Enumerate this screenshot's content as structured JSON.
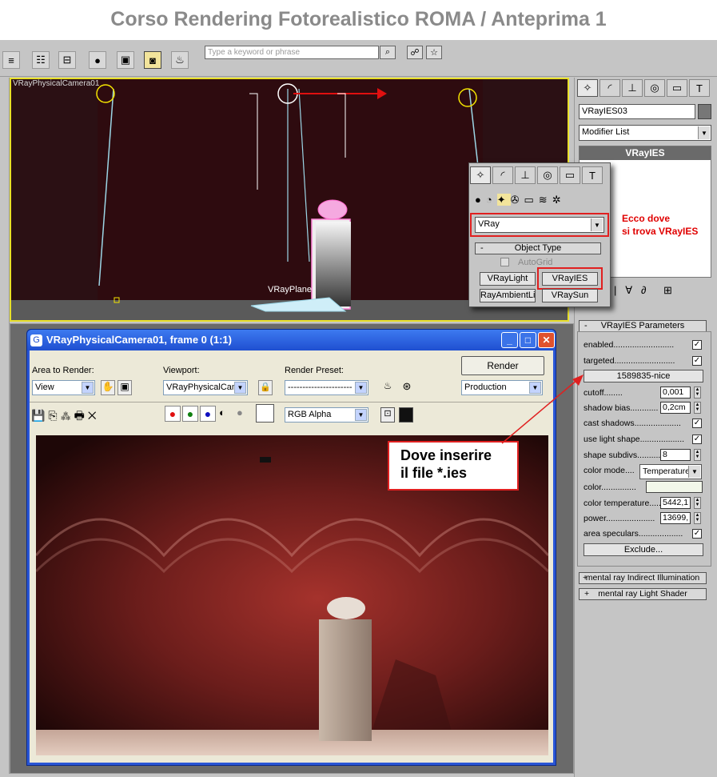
{
  "header": {
    "title": "Corso Rendering Fotorealistico ROMA / Anteprima 1"
  },
  "toolbar": {
    "search_placeholder": "Type a keyword or phrase"
  },
  "viewport": {
    "label": "VRayPhysicalCamera01",
    "plane_label": "VRayPlane"
  },
  "command_panel": {
    "object_name": "VRayIES03",
    "modifier_list": "Modifier List",
    "stack_item": "VRayIES"
  },
  "popup": {
    "category": "VRay",
    "rollout_title": "Object Type",
    "collapse_sign": "-",
    "autogrid": "AutoGrid",
    "buttons": [
      "VRayLight",
      "VRayIES",
      "RayAmbientLig",
      "VRaySun"
    ]
  },
  "annotations": {
    "ecco_line1": "Ecco dove",
    "ecco_line2": "si trova VRayIES",
    "dove_line1": "Dove inserire",
    "dove_line2": "il file *.ies"
  },
  "params": {
    "rollout_title": "VRayIES Parameters",
    "collapse_sign": "-",
    "enabled": "enabled..........................",
    "targeted": "targeted..........................",
    "ies_file": "1589835-nice",
    "cutoff": "cutoff........",
    "cutoff_val": "0,001",
    "shadow_bias": "shadow bias............",
    "shadow_bias_val": "0,2cm",
    "cast_shadows": "cast shadows....................",
    "use_light_shape": "use light shape...................",
    "shape_subdivs": "shape subdivs...........",
    "shape_subdivs_val": "8",
    "color_mode": "color mode....",
    "color_mode_val": "Temperature",
    "color": "color...............",
    "color_temperature": "color temperature......",
    "color_temperature_val": "5442,1",
    "power": "power.....................",
    "power_val": "13699,",
    "area_speculars": "area speculars...................",
    "exclude": "Exclude...",
    "mr_indirect": "mental ray Indirect Illumination",
    "mr_indirect_sign": "+",
    "mr_shader": "mental ray Light Shader",
    "mr_shader_sign": "+",
    "colors": {
      "color_swatch": "#f2f7ea"
    }
  },
  "render_window": {
    "title": "VRayPhysicalCamera01, frame 0 (1:1)",
    "area_label": "Area to Render:",
    "area_value": "View",
    "viewport_label": "Viewport:",
    "viewport_value": "VRayPhysicalCam",
    "preset_label": "Render Preset:",
    "preset_value": "----------------------",
    "render_button": "Render",
    "production_value": "Production",
    "channel_value": "RGB Alpha",
    "min_glyph": "_",
    "max_glyph": "□",
    "close_glyph": "✕"
  }
}
